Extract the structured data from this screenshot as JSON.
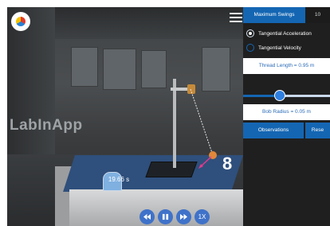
{
  "watermark": "LabInApp",
  "timer": "19.66 s",
  "swing_count": "8",
  "playback": {
    "rewind_icon": "rewind-icon",
    "pause_icon": "pause-icon",
    "forward_icon": "fast-forward-icon",
    "speed_label": "1X"
  },
  "panel": {
    "tabs": [
      {
        "label": "Maximum Swings",
        "active": true
      },
      {
        "label": "10",
        "active": false
      }
    ],
    "options": [
      {
        "label": "Tangential Acceleration",
        "selected": true
      },
      {
        "label": "Tangential Velocity",
        "selected": false
      }
    ],
    "thread_length_label": "Thread Length = 0.95 m",
    "slider_value_fraction": 0.42,
    "bob_radius_label": "Bob Radius = 0.05 m",
    "buttons": {
      "observations": "Observations",
      "reset": "Rese"
    }
  },
  "colors": {
    "accent": "#1466b3",
    "table": "#2f4f7c",
    "bob": "#e0873a",
    "arrow": "#e23a8a"
  }
}
